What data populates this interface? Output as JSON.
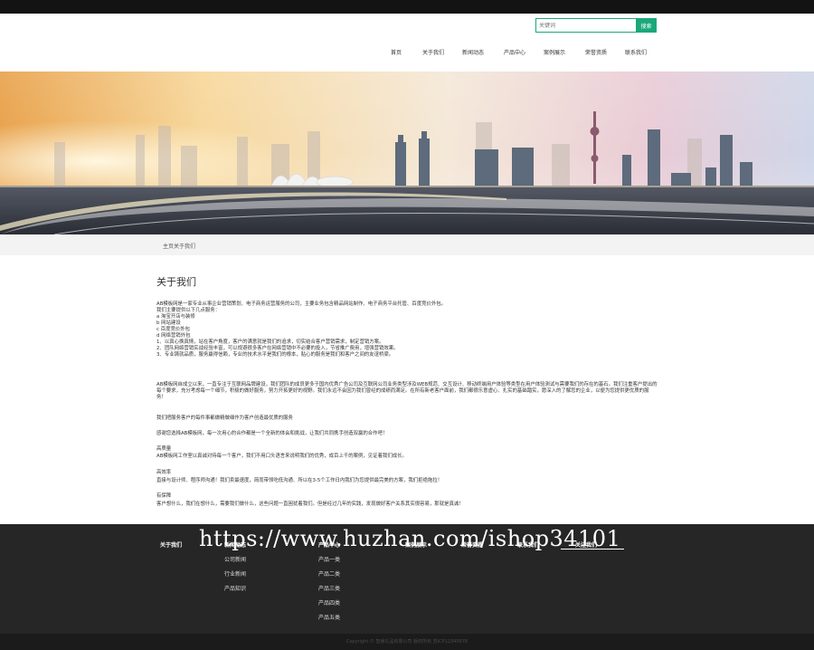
{
  "search": {
    "placeholder": "关键词",
    "button_label": "搜索"
  },
  "nav": [
    {
      "label": "首页"
    },
    {
      "label": "关于我们"
    },
    {
      "label": "新闻动态"
    },
    {
      "label": "产品中心"
    },
    {
      "label": "案例展示"
    },
    {
      "label": "荣誉资质"
    },
    {
      "label": "联系我们"
    }
  ],
  "breadcrumb": "主页关于我们",
  "article": {
    "title": "关于我们",
    "p1": [
      "AB模板网是一家专业从事企业营销策划、电子商务运营服务的公司，主要业务包含精品网站制作、电子商务平台托管、百度竞价外包。",
      "我们主要提供以下几点服务：",
      "a  淘宝开店与装修",
      "b  网站建设",
      "c  百度竞价外包",
      "d  网络营销外包",
      "1、以真心换真情，站在客户角度，客户的满意就是我们的追求，切实结合客户营销需求，制定营销方案。",
      "2、团队网络营销实战经验丰富，可以规避很多客户在网络营销中不必要的投入，节省推广费用，增强营销效果。",
      "3、专业铸就品质，服务赢得信赖，专业的技术水平是我们的根本，贴心的服务是我们和客户之间的友谊桥梁。"
    ],
    "p2": "AB模板网自成立以来，一直专注于互联网品牌建设，我们团队的成员更多于国内优秀广告公司及互联网公司业务类型涉及WEB规范、交互设计、移动终端用户体验等类型在用户体验测试与需要我们的存在的基石。我们注重客户提出的每个要求，充分考虑每一个细节，积极的做好服务，努力开拓更好的视野。我们永远不会因为我们曾经的成绩而满足。在所有新老客户面前，我们都很乐意虚心、扎实的基础踏实，愿深入的了解您的企业，以便为您提供更优质的服务！",
    "p3": "我们把服务客户的每件事都做精做细作为客户创造最优质的服务",
    "p4": "感谢您选择AB模板网，每一次用心的合作都是一个全新的体会和挑战，让我们共同携手创造双赢的合作吧！",
    "p5_head": "高质量",
    "p5": "AB模板网工作室以真诚对待每一个客户，我们不用口头语言来说明我们的优秀，成百上千的案例，见证着我们成长。",
    "p6_head": "高效率",
    "p6": "直接与设计师、程序师沟通！我们卖最速度，简而带领吃低沟通、所以在3-5个工作日内我们为您提供最完美的方案，我们拒绝拖拉！",
    "p7_head": "有保障",
    "p7": "客户想什么，我们在想什么，需要我们做什么，这些问题一直困扰着我们。但是经过几年的实践，发现做好客户关系其实很容易，那就是真诚！"
  },
  "footer": {
    "columns": [
      {
        "head": "关于我们",
        "links": []
      },
      {
        "head": "新闻动态",
        "links": [
          "公司新闻",
          "行业新闻",
          "产品知识"
        ]
      },
      {
        "head": "产品中心",
        "links": [
          "产品一类",
          "产品二类",
          "产品三类",
          "产品四类",
          "产品五类"
        ]
      },
      {
        "head": "案例展示",
        "links": []
      },
      {
        "head": "荣誉资质",
        "links": []
      },
      {
        "head": "联系我们",
        "links": []
      },
      {
        "head": "关注我们",
        "links": []
      }
    ],
    "watermark": "https://www.huzhan.com/ishop34101",
    "copyright": "Copyright © 智睿礼品有限公司 版权所有  苏ICP12345678"
  },
  "colors": {
    "accent": "#1aa87a",
    "footer_bg": "#262626",
    "topbar": "#131313"
  }
}
